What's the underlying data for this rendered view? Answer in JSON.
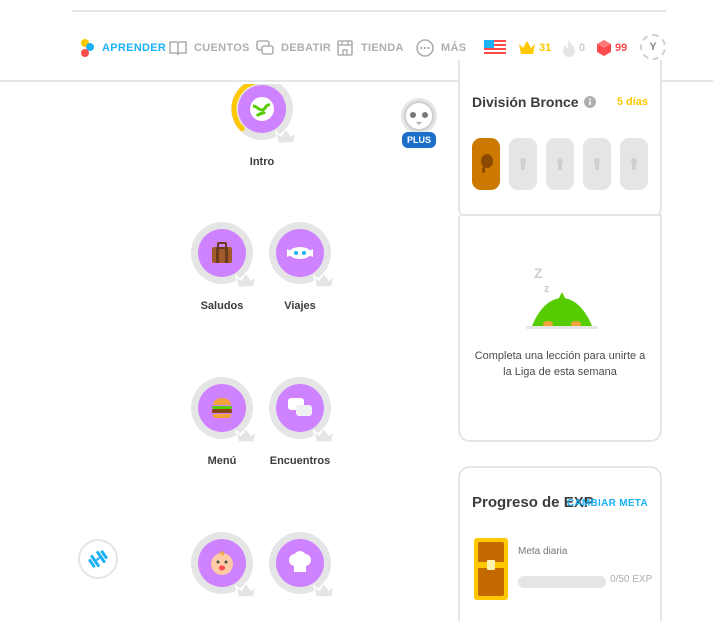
{
  "nav": {
    "items": [
      {
        "label": "APRENDER",
        "icon": "learn-icon",
        "active": true
      },
      {
        "label": "CUENTOS",
        "icon": "book-icon",
        "active": false
      },
      {
        "label": "DEBATIR",
        "icon": "discuss-icon",
        "active": false
      },
      {
        "label": "TIENDA",
        "icon": "shop-icon",
        "active": false
      },
      {
        "label": "MÁS",
        "icon": "more-icon",
        "active": false
      }
    ]
  },
  "stats": {
    "language": "english-flag-icon",
    "crowns": "31",
    "streak": "0",
    "gems": "99",
    "avatar_initial": "Y"
  },
  "course": {
    "lessons": [
      {
        "label": "Intro",
        "icon": "intro-icon",
        "progress": 0.4
      },
      {
        "label": "Saludos",
        "icon": "suitcase-icon"
      },
      {
        "label": "Viajes",
        "icon": "airplane-icon"
      },
      {
        "label": "Menú",
        "icon": "burger-icon"
      },
      {
        "label": "Encuentros",
        "icon": "chat-bubbles-icon"
      },
      {
        "label": "",
        "icon": "baby-icon"
      },
      {
        "label": "",
        "icon": "chef-hat-icon"
      }
    ],
    "plus_badge": "PLUS"
  },
  "league": {
    "title": "División Bronce",
    "days": "5 días",
    "message": "Completa una lección para unirte a la Liga de esta semana"
  },
  "exp": {
    "title": "Progreso de EXP",
    "change_goal": "CAMBIAR META",
    "goal_label": "Meta diaria",
    "progress": "0/50 EXP",
    "progress_fraction": 0
  },
  "colors": {
    "accent_blue": "#1cb0f6",
    "lesson_purple": "#ce82ff",
    "gold": "#ffc800",
    "gem_red": "#ff4b4b",
    "green": "#58cc02"
  }
}
